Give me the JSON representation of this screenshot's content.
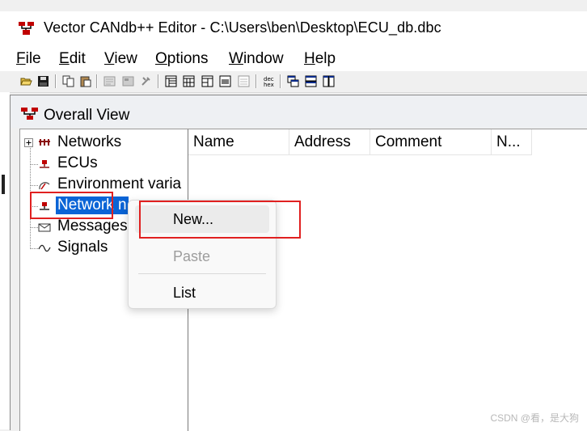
{
  "window": {
    "title": "Vector CANdb++ Editor - C:\\Users\\ben\\Desktop\\ECU_db.dbc"
  },
  "menu": [
    {
      "label": "File",
      "accel": "F",
      "rest": "ile"
    },
    {
      "label": "Edit",
      "accel": "E",
      "rest": "dit"
    },
    {
      "label": "View",
      "accel": "V",
      "rest": "iew"
    },
    {
      "label": "Options",
      "accel": "O",
      "rest": "ptions"
    },
    {
      "label": "Window",
      "accel": "W",
      "rest": "indow"
    },
    {
      "label": "Help",
      "accel": "H",
      "rest": "elp"
    }
  ],
  "toolbar": {
    "icons": [
      "open-icon",
      "save-icon",
      "copy-icon",
      "paste-icon",
      "properties-icon",
      "attributes-icon",
      "tools-icon",
      "view-list-icon",
      "view-grid-icon",
      "view-details-icon",
      "view-image-icon",
      "view-report-icon",
      "hex-dec-icon",
      "cascade-icon",
      "tile-horizontal-icon",
      "tile-vertical-icon"
    ]
  },
  "child_window": {
    "title": "Overall View"
  },
  "tree": {
    "items": [
      {
        "label": "Networks",
        "icon": "networks-icon"
      },
      {
        "label": "ECUs",
        "icon": "ecu-icon"
      },
      {
        "label": "Environment varia",
        "icon": "environment-icon"
      },
      {
        "label": "Network node",
        "visible_label": "Network n",
        "icon": "node-icon",
        "selected": true
      },
      {
        "label": "Messages",
        "icon": "message-icon"
      },
      {
        "label": "Signals",
        "icon": "signal-icon"
      }
    ]
  },
  "grid": {
    "columns": [
      "Name",
      "Address",
      "Comment",
      "N..."
    ]
  },
  "context_menu": {
    "items": [
      {
        "label": "New...",
        "state": "hover"
      },
      {
        "label": "Paste",
        "state": "disabled"
      },
      {
        "label": "List",
        "state": "normal"
      }
    ]
  },
  "watermark": "CSDN @看，是大狗",
  "colors": {
    "selection": "#0a64d6",
    "annotation": "#e02020"
  }
}
